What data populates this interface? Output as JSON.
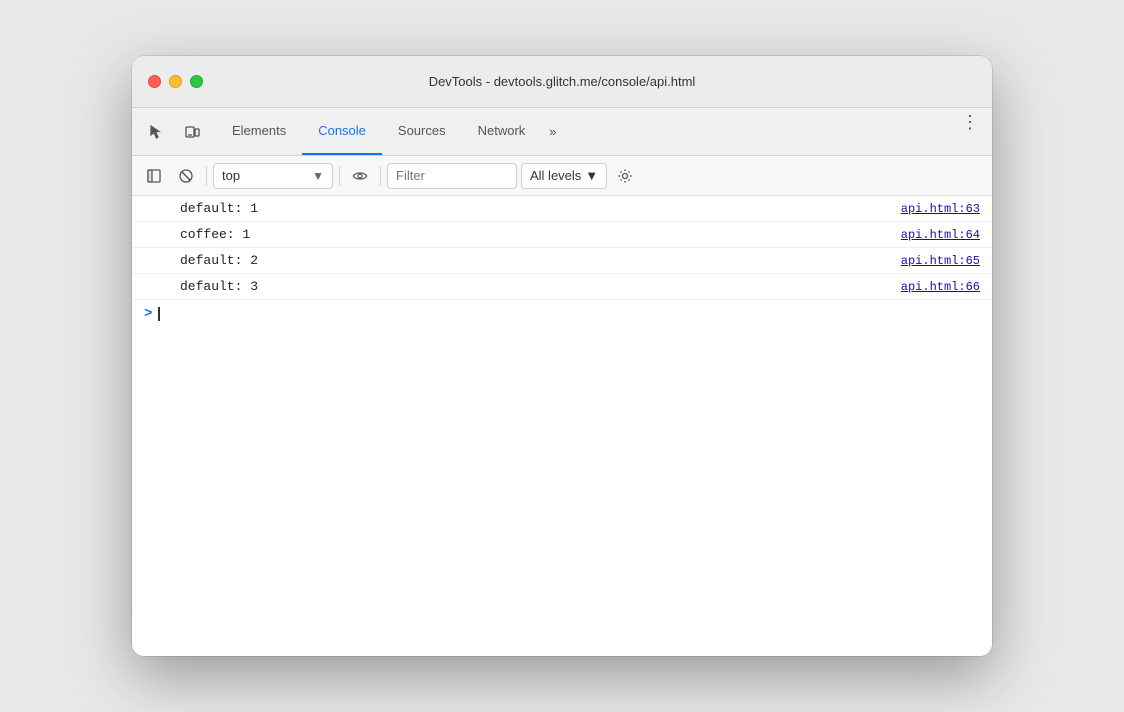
{
  "window": {
    "title": "DevTools - devtools.glitch.me/console/api.html"
  },
  "traffic_lights": {
    "close_label": "close",
    "minimize_label": "minimize",
    "maximize_label": "maximize"
  },
  "tabs": [
    {
      "id": "elements",
      "label": "Elements",
      "active": false
    },
    {
      "id": "console",
      "label": "Console",
      "active": true
    },
    {
      "id": "sources",
      "label": "Sources",
      "active": false
    },
    {
      "id": "network",
      "label": "Network",
      "active": false
    }
  ],
  "tab_more": "»",
  "tab_menu": "⋮",
  "console_toolbar": {
    "clear_label": "🚫",
    "context_value": "top",
    "context_arrow": "▼",
    "filter_placeholder": "Filter",
    "levels_label": "All levels",
    "levels_arrow": "▼"
  },
  "console_logs": [
    {
      "text": "default: 1",
      "source": "api.html:63"
    },
    {
      "text": "coffee: 1",
      "source": "api.html:64"
    },
    {
      "text": "default: 2",
      "source": "api.html:65"
    },
    {
      "text": "default: 3",
      "source": "api.html:66"
    }
  ],
  "console_input": {
    "prompt": ">"
  }
}
